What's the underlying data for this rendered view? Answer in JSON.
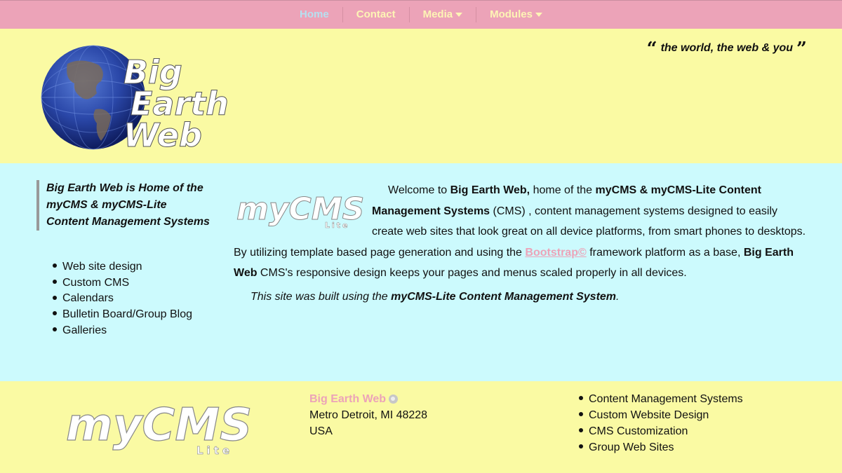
{
  "nav": {
    "items": [
      {
        "label": "Home",
        "active": true,
        "dropdown": false
      },
      {
        "label": "Contact",
        "active": false,
        "dropdown": false
      },
      {
        "label": "Media",
        "active": false,
        "dropdown": true
      },
      {
        "label": "Modules",
        "active": false,
        "dropdown": true
      }
    ]
  },
  "header": {
    "tagline": "the world, the web & you",
    "logo_lines": [
      "Big",
      "Earth",
      "Web"
    ]
  },
  "sidebar": {
    "intro": "Big Earth Web is Home of the myCMS & myCMS-Lite Content Management Systems",
    "items": [
      "Web site design",
      "Custom CMS",
      "Calendars",
      "Bulletin Board/Group Blog",
      "Galleries"
    ]
  },
  "content": {
    "logo_text": "myCMS",
    "logo_sub": "Lite",
    "p1_a": "Welcome to ",
    "p1_b": "Big Earth Web,",
    "p1_c": " home of the ",
    "p1_d": "myCMS & myCMS-Lite Content Management Systems",
    "p1_e": " (CMS) , content management systems designed to easily create web sites that look great on all device platforms, from smart phones to desktops. By utilizing template based page generation and using the ",
    "p1_link": "Bootstrap©",
    "p1_f": " framework platform as a base, ",
    "p1_g": "Big Earth Web",
    "p1_h": " CMS's responsive design keeps your pages and menus scaled properly in all devices.",
    "built_a": "This site was built using the ",
    "built_b": "myCMS-Lite Content Management System",
    "built_c": "."
  },
  "footer": {
    "logo_text": "myCMS",
    "logo_sub": "Lite",
    "company": "Big Earth Web",
    "city": "Metro Detroit, MI 48228",
    "country": "USA",
    "services": [
      "Content Management Systems",
      "Custom Website Design",
      "CMS Customization",
      "Group Web Sites"
    ]
  },
  "colors": {
    "nav_bg": "#eca3b8",
    "header_bg": "#fafaa3",
    "main_bg": "#ccfafd",
    "accent": "#eca3b8"
  }
}
